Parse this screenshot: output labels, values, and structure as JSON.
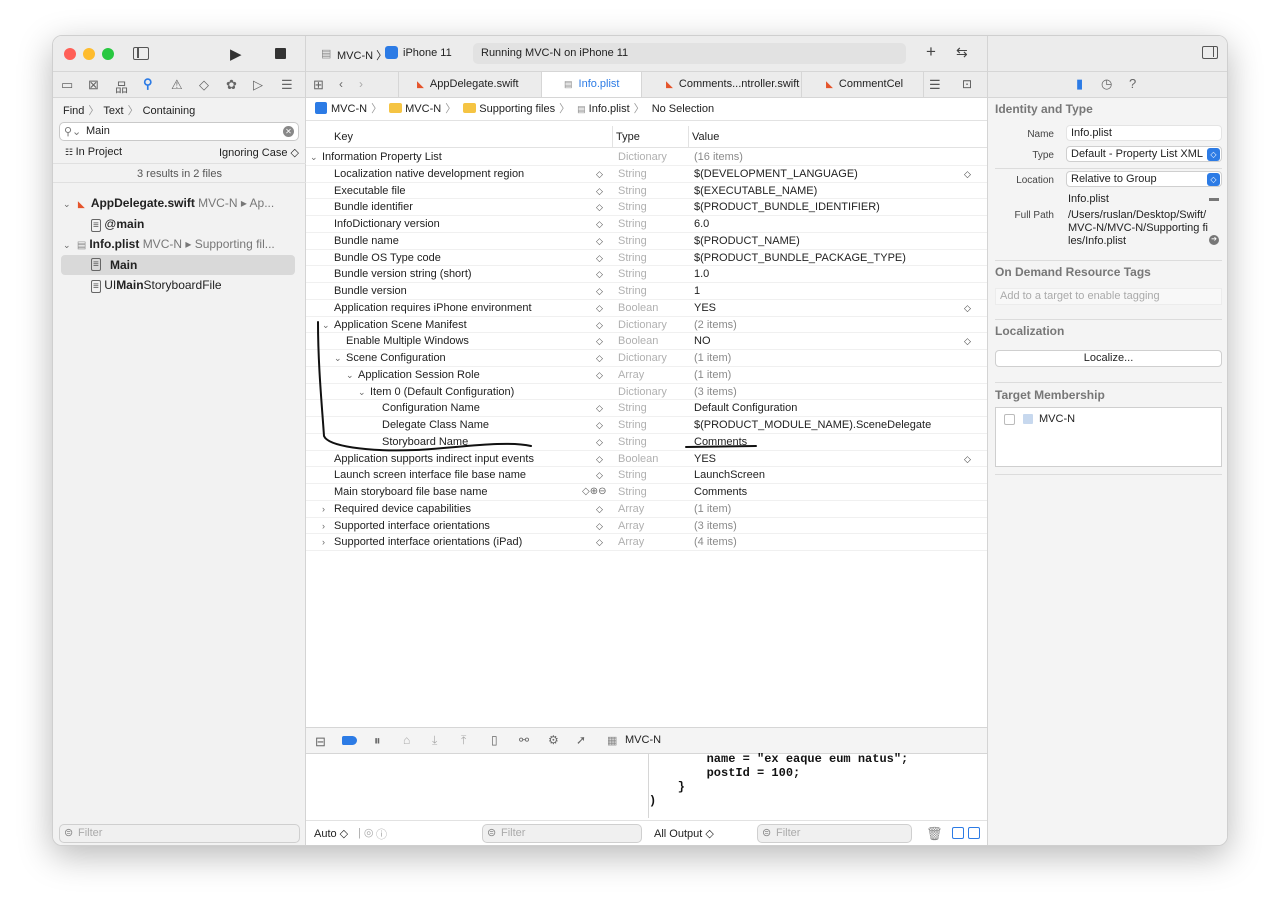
{
  "toolbar": {
    "scheme": "MVC-N",
    "device": "iPhone 11",
    "status": "Running MVC-N on iPhone 11",
    "add": "+",
    "swap": "⇆"
  },
  "navigator": {
    "find_path": [
      "Find",
      "Text",
      "Containing"
    ],
    "search_value": "Main",
    "scope": "In Project",
    "case": "Ignoring Case ◇",
    "results_summary": "3 results in 2 files",
    "results": [
      {
        "file": "AppDelegate.swift",
        "detail": "MVC-N ▸ Ap...",
        "match_prefix": "@",
        "match": "main",
        "match_suffix": ""
      },
      {
        "file": "Info.plist",
        "detail": "MVC-N ▸ Supporting fil...",
        "matches": [
          {
            "prefix": "",
            "match": "Main",
            "suffix": ""
          },
          {
            "prefix": "UI",
            "match": "Main",
            "suffix": "StoryboardFile"
          }
        ]
      }
    ],
    "filter_placeholder": "Filter"
  },
  "tabs": [
    {
      "label": "AppDelegate.swift",
      "active": false
    },
    {
      "label": "Info.plist",
      "active": true
    },
    {
      "label": "Comments...ntroller.swift",
      "active": false
    },
    {
      "label": "CommentCel",
      "active": false
    }
  ],
  "breadcrumb": [
    "MVC-N",
    "MVC-N",
    "Supporting files",
    "Info.plist",
    "No Selection"
  ],
  "plist": {
    "columns": {
      "key": "Key",
      "type": "Type",
      "value": "Value"
    },
    "rows": [
      {
        "indent": 0,
        "arrow": "⌄",
        "key": "Information Property List",
        "type": "Dictionary",
        "value": "(16 items)",
        "stepper": false
      },
      {
        "indent": 1,
        "key": "Localization native development region",
        "type": "String",
        "value": "$(DEVELOPMENT_LANGUAGE)",
        "stepper": true,
        "vstep": true
      },
      {
        "indent": 1,
        "key": "Executable file",
        "type": "String",
        "value": "$(EXECUTABLE_NAME)",
        "stepper": true
      },
      {
        "indent": 1,
        "key": "Bundle identifier",
        "type": "String",
        "value": "$(PRODUCT_BUNDLE_IDENTIFIER)",
        "stepper": true
      },
      {
        "indent": 1,
        "key": "InfoDictionary version",
        "type": "String",
        "value": "6.0",
        "stepper": true
      },
      {
        "indent": 1,
        "key": "Bundle name",
        "type": "String",
        "value": "$(PRODUCT_NAME)",
        "stepper": true
      },
      {
        "indent": 1,
        "key": "Bundle OS Type code",
        "type": "String",
        "value": "$(PRODUCT_BUNDLE_PACKAGE_TYPE)",
        "stepper": true
      },
      {
        "indent": 1,
        "key": "Bundle version string (short)",
        "type": "String",
        "value": "1.0",
        "stepper": true
      },
      {
        "indent": 1,
        "key": "Bundle version",
        "type": "String",
        "value": "1",
        "stepper": true
      },
      {
        "indent": 1,
        "key": "Application requires iPhone environment",
        "type": "Boolean",
        "value": "YES",
        "stepper": true,
        "vstep": true
      },
      {
        "indent": 1,
        "arrow": "⌄",
        "key": "Application Scene Manifest",
        "type": "Dictionary",
        "value": "(2 items)",
        "stepper": true
      },
      {
        "indent": 2,
        "key": "Enable Multiple Windows",
        "type": "Boolean",
        "value": "NO",
        "stepper": true,
        "vstep": true
      },
      {
        "indent": 2,
        "arrow": "⌄",
        "key": "Scene Configuration",
        "type": "Dictionary",
        "value": "(1 item)",
        "stepper": true
      },
      {
        "indent": 3,
        "arrow": "⌄",
        "key": "Application Session Role",
        "type": "Array",
        "value": "(1 item)",
        "stepper": true
      },
      {
        "indent": 4,
        "arrow": "⌄",
        "key": "Item 0 (Default Configuration)",
        "type": "Dictionary",
        "value": "(3 items)",
        "stepper": false
      },
      {
        "indent": 5,
        "key": "Configuration Name",
        "type": "String",
        "value": "Default Configuration",
        "stepper": true
      },
      {
        "indent": 5,
        "key": "Delegate Class Name",
        "type": "String",
        "value": "$(PRODUCT_MODULE_NAME).SceneDelegate",
        "stepper": true
      },
      {
        "indent": 5,
        "key": "Storyboard Name",
        "type": "String",
        "value": "Comments",
        "stepper": true
      },
      {
        "indent": 1,
        "key": "Application supports indirect input events",
        "type": "Boolean",
        "value": "YES",
        "stepper": true,
        "vstep": true
      },
      {
        "indent": 1,
        "key": "Launch screen interface file base name",
        "type": "String",
        "value": "LaunchScreen",
        "stepper": true
      },
      {
        "indent": 1,
        "key": "Main storyboard file base name",
        "type": "String",
        "value": "Comments",
        "stepper": true,
        "addremove": true
      },
      {
        "indent": 1,
        "arrow": "›",
        "key": "Required device capabilities",
        "type": "Array",
        "value": "(1 item)",
        "stepper": true
      },
      {
        "indent": 1,
        "arrow": "›",
        "key": "Supported interface orientations",
        "type": "Array",
        "value": "(3 items)",
        "stepper": true
      },
      {
        "indent": 1,
        "arrow": "›",
        "key": "Supported interface orientations (iPad)",
        "type": "Array",
        "value": "(4 items)",
        "stepper": true
      }
    ]
  },
  "debug": {
    "target": "MVC-N",
    "console_lines": [
      "        name = \"ex eaque eum natus\";",
      "        postId = 100;",
      "    }",
      ")"
    ],
    "auto": "Auto ◇",
    "all_output": "All Output ◇",
    "filter_placeholder": "Filter"
  },
  "inspector": {
    "identity_header": "Identity and Type",
    "name_label": "Name",
    "name_value": "Info.plist",
    "type_label": "Type",
    "type_value": "Default - Property List XML",
    "location_label": "Location",
    "location_value": "Relative to Group",
    "location_file": "Info.plist",
    "fullpath_label": "Full Path",
    "fullpath_value": "/Users/ruslan/Desktop/Swift/MVC-N/MVC-N/Supporting files/Info.plist",
    "odr_header": "On Demand Resource Tags",
    "odr_placeholder": "Add to a target to enable tagging",
    "localization_header": "Localization",
    "localize_button": "Localize...",
    "membership_header": "Target Membership",
    "membership_target": "MVC-N"
  }
}
